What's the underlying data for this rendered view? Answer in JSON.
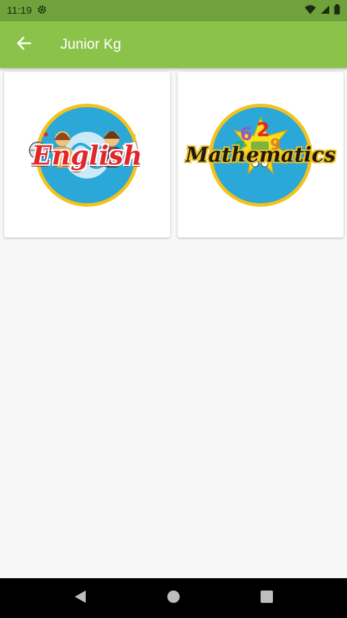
{
  "status_bar": {
    "time": "11:19",
    "icons": [
      "gear-icon",
      "wifi-icon",
      "signal-icon",
      "battery-icon"
    ]
  },
  "app_bar": {
    "title": "Junior Kg",
    "back_icon": "arrow-left-icon"
  },
  "subjects": [
    {
      "label": "English",
      "icon": "english-logo"
    },
    {
      "label": "Mathematics",
      "icon": "mathematics-logo"
    }
  ],
  "nav_bar": {
    "icons": [
      "back-triangle-icon",
      "home-circle-icon",
      "recents-square-icon"
    ]
  },
  "colors": {
    "status_bar": "#6fa23a",
    "app_bar": "#8bc34a",
    "background": "#f7f7f7",
    "english_text": "#e3262a",
    "logo_disc": "#2ba8d8",
    "logo_ring": "#f4c21b"
  }
}
